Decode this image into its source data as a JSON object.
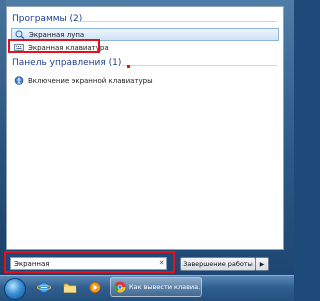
{
  "start_menu": {
    "programs_header": "Программы (2)",
    "programs": [
      {
        "label": "Экранная лупа",
        "icon": "magnifier-icon"
      },
      {
        "label": "Экранная клавиатура",
        "icon": "keyboard-icon"
      }
    ],
    "control_panel_header": "Панель управления (1)",
    "control_panel_items": [
      {
        "label": "Включение экранной клавиатуры",
        "icon": "ease-of-access-icon"
      }
    ],
    "search": {
      "value": "Экранная",
      "clear_glyph": "✕"
    },
    "shutdown": {
      "label": "Завершение работы",
      "arrow": "▶"
    }
  },
  "taskbar": {
    "active_window_label": "Как вывести клавиа...",
    "icons": [
      "start-orb-icon",
      "ie-icon",
      "folder-icon",
      "media-player-icon",
      "chrome-icon"
    ]
  },
  "colors": {
    "accent_red": "#e3111b",
    "header_text": "#1e3f8f",
    "highlight": "#cfe2f7"
  }
}
